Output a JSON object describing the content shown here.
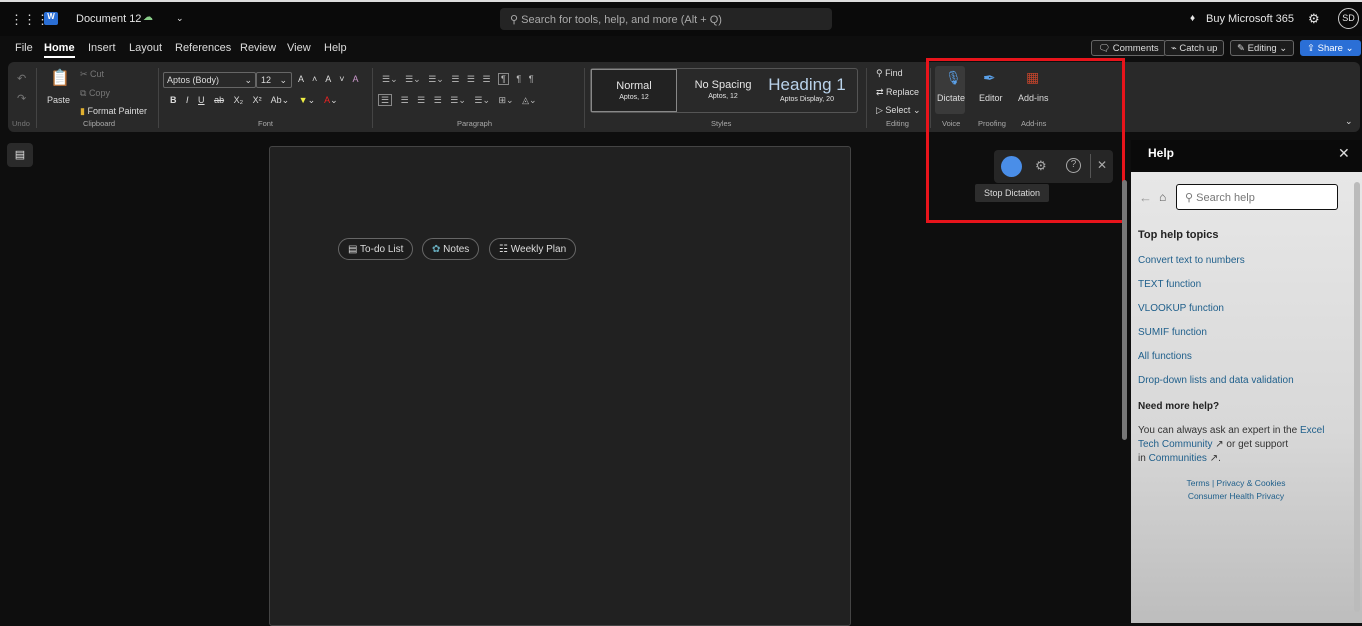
{
  "titlebar": {
    "doc_title": "Document 12",
    "search_placeholder": "Search for tools, help, and more (Alt + Q)",
    "buy": "Buy Microsoft 365",
    "avatar": "SD"
  },
  "menu": {
    "tabs": [
      "File",
      "Home",
      "Insert",
      "Layout",
      "References",
      "Review",
      "View",
      "Help"
    ],
    "comments": "Comments",
    "catchup": "Catch up",
    "editing": "Editing",
    "share": "Share"
  },
  "ribbon": {
    "undo_group": "Undo",
    "paste": "Paste",
    "cut": "Cut",
    "copy": "Copy",
    "format_painter": "Format Painter",
    "clipboard_group": "Clipboard",
    "font_name": "Aptos (Body)",
    "font_size": "12",
    "font_group": "Font",
    "paragraph_group": "Paragraph",
    "styles": [
      {
        "name": "Normal",
        "sub": "Aptos, 12"
      },
      {
        "name": "No Spacing",
        "sub": "Aptos, 12"
      },
      {
        "name": "Heading 1",
        "sub": "Aptos Display, 20"
      }
    ],
    "styles_group": "Styles",
    "find": "Find",
    "replace": "Replace",
    "select": "Select",
    "editing_group": "Editing",
    "dictate": "Dictate",
    "voice_group": "Voice",
    "editor": "Editor",
    "proofing_group": "Proofing",
    "addins": "Add-ins",
    "addins_group": "Add-ins"
  },
  "doc": {
    "chips": [
      "To-do List",
      "Notes",
      "Weekly Plan"
    ]
  },
  "dictation": {
    "tooltip": "Stop Dictation"
  },
  "help": {
    "title": "Help",
    "search_placeholder": "Search help",
    "top_heading": "Top help topics",
    "topics": [
      "Convert text to numbers",
      "TEXT function",
      "VLOOKUP function",
      "SUMIF function",
      "All functions",
      "Drop-down lists and data validation"
    ],
    "more_heading": "Need more help?",
    "more_text1": "You can always ask an expert in the",
    "excel_link": "Excel",
    "tech_link": "Tech Community",
    "more_text2": " or get support",
    "more_text3": "in",
    "communities_link": "Communities",
    "terms": "Terms",
    "privacy": "Privacy & Cookies",
    "consumer": "Consumer Health Privacy"
  },
  "colors": {
    "accent": "#2b6fd6",
    "highlight_box": "#e8141b"
  }
}
